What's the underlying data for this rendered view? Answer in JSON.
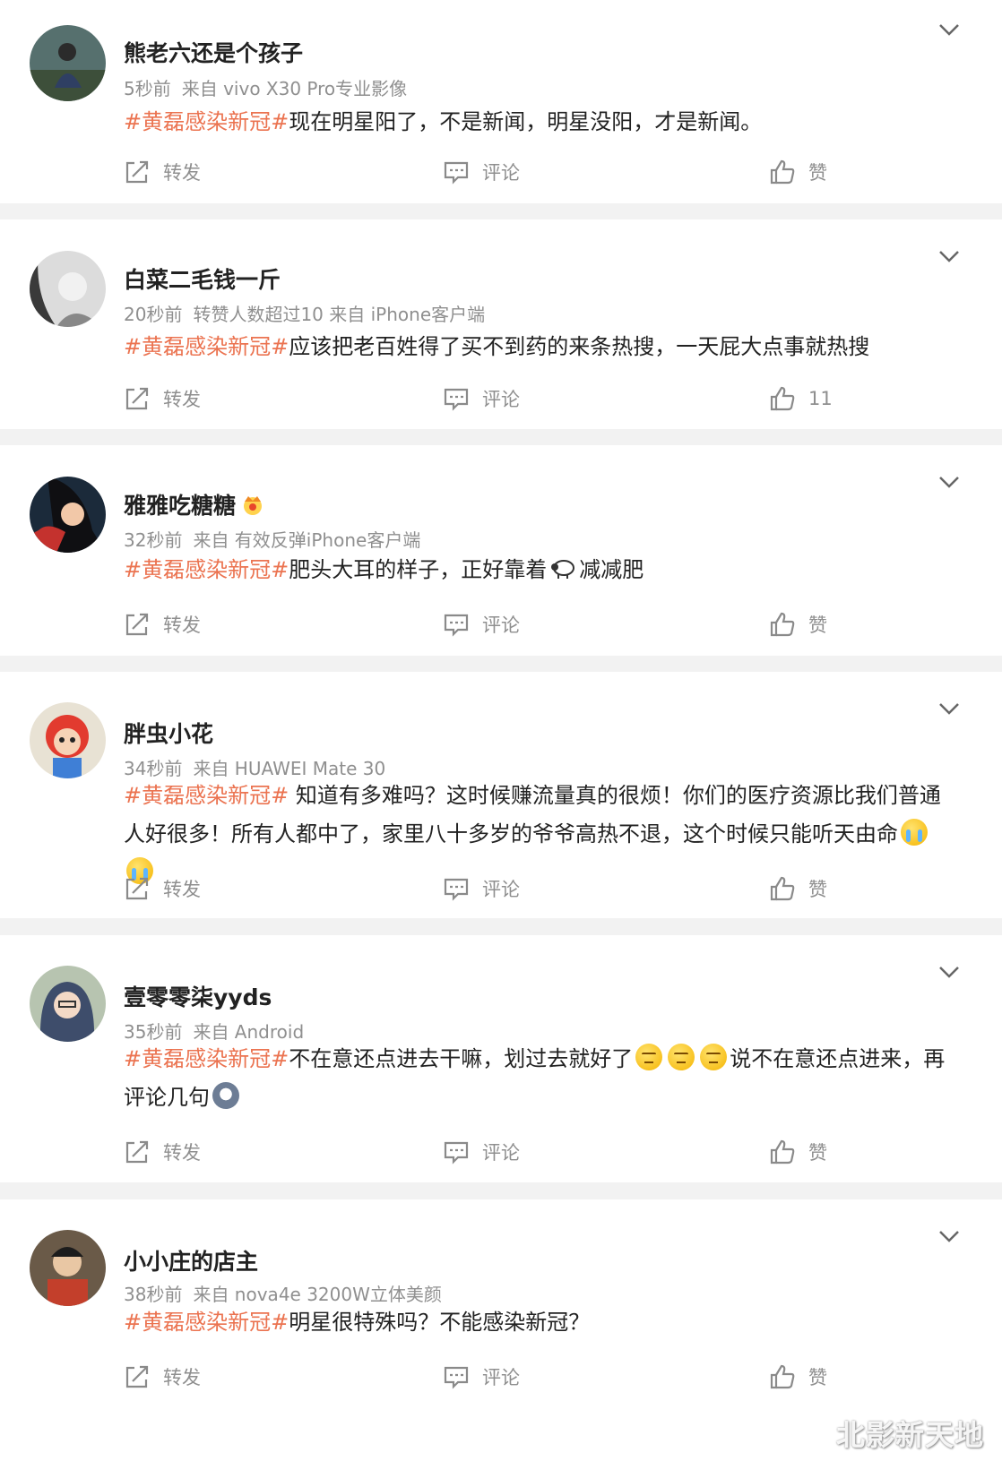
{
  "colors": {
    "topic": "#eb7350",
    "meta": "#8f8f8f",
    "text": "#222222",
    "divider": "#f2f2f2"
  },
  "icons": {
    "forward": "forward-icon",
    "comment": "comment-icon",
    "like": "thumbs-up-icon",
    "menu": "chevron-down-icon"
  },
  "posts": [
    {
      "username": "熊老六还是个孩子",
      "time": "5秒前",
      "source": "来自 vivo X30 Pro专业影像",
      "topic": "#黄磊感染新冠#",
      "text": "现在明星阳了，不是新闻，明星没阳，才是新闻。",
      "forward_label": "转发",
      "comment_label": "评论",
      "like_label": "赞"
    },
    {
      "username": "白菜二毛钱一斤",
      "time": "20秒前",
      "source": "转赞人数超过10  来自 iPhone客户端",
      "topic": "#黄磊感染新冠#",
      "text": "应该把老百姓得了买不到药的来条热搜，一天屁大点事就热搜",
      "forward_label": "转发",
      "comment_label": "评论",
      "like_label": "11"
    },
    {
      "username": "雅雅吃糖糖",
      "time": "32秒前",
      "source": "来自 有效反弹iPhone客户端",
      "topic": "#黄磊感染新冠#",
      "text": "肥头大耳的样子，正好靠着",
      "text_after": "减减肥",
      "forward_label": "转发",
      "comment_label": "评论",
      "like_label": "赞"
    },
    {
      "username": "胖虫小花",
      "time": "34秒前",
      "source": "来自 HUAWEI Mate 30",
      "topic": "#黄磊感染新冠#",
      "text": " 知道有多难吗？这时候赚流量真的很烦！你们的医疗资源比我们普通人好很多！所有人都中了，家里八十多岁的爷爷高热不退，这个时候只能听天由命",
      "forward_label": "转发",
      "comment_label": "评论",
      "like_label": "赞"
    },
    {
      "username": "壹零零柒yyds",
      "time": "35秒前",
      "source": "来自 Android",
      "topic": "#黄磊感染新冠#",
      "text": "不在意还点进去干嘛，划过去就好了",
      "text_after": "说不在意还点进来，再评论几句",
      "forward_label": "转发",
      "comment_label": "评论",
      "like_label": "赞"
    },
    {
      "username": "小小庄的店主",
      "time": "38秒前",
      "source": "来自 nova4e 3200W立体美颜",
      "topic": "#黄磊感染新冠#",
      "text": "明星很特殊吗？不能感染新冠？",
      "forward_label": "转发",
      "comment_label": "评论",
      "like_label": "赞"
    }
  ],
  "watermark": "北影新天地"
}
